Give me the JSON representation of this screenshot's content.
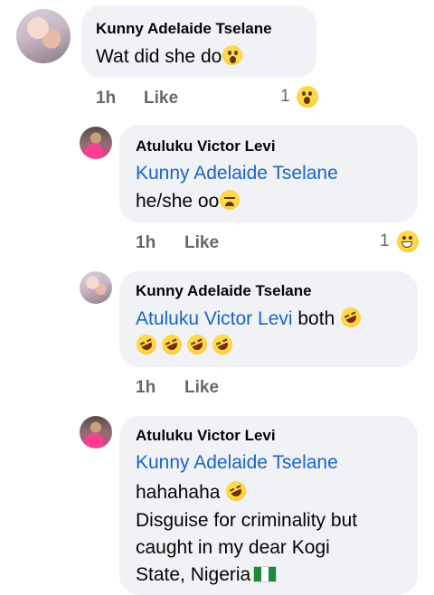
{
  "comments": [
    {
      "author": "Kunny Adelaide Tselane",
      "lines": [
        {
          "text": "Wat did she do",
          "emoji": "astonished-emoji"
        }
      ],
      "time": "1h",
      "like": "Like",
      "reaction_count": "1",
      "reaction_emoji": "astonished-emoji"
    },
    {
      "author": "Atuluku Victor Levi",
      "mention": "Kunny Adelaide Tselane",
      "lines": [
        {
          "text": "he/she oo",
          "emoji": "weary-emoji"
        }
      ],
      "time": "1h",
      "like": "Like",
      "reaction_count": "1",
      "reaction_emoji": "grinning-emoji"
    },
    {
      "author": "Kunny Adelaide Tselane",
      "mention": "Atuluku Victor Levi",
      "mention_suffix": " both",
      "lines": [
        {
          "text": "",
          "emoji": "rolling-on-floor-laughing-emoji x4"
        }
      ],
      "time": "1h",
      "like": "Like"
    },
    {
      "author": "Atuluku Victor Levi",
      "mention": "Kunny Adelaide Tselane",
      "lines": [
        {
          "text": "hahahaha",
          "emoji": "rolling-on-floor-laughing-emoji"
        },
        {
          "text": "Disguise for criminality but"
        },
        {
          "text": "caught in my dear Kogi"
        },
        {
          "text": "State, Nigeria",
          "emoji": "nigeria-flag-emoji"
        }
      ]
    }
  ]
}
